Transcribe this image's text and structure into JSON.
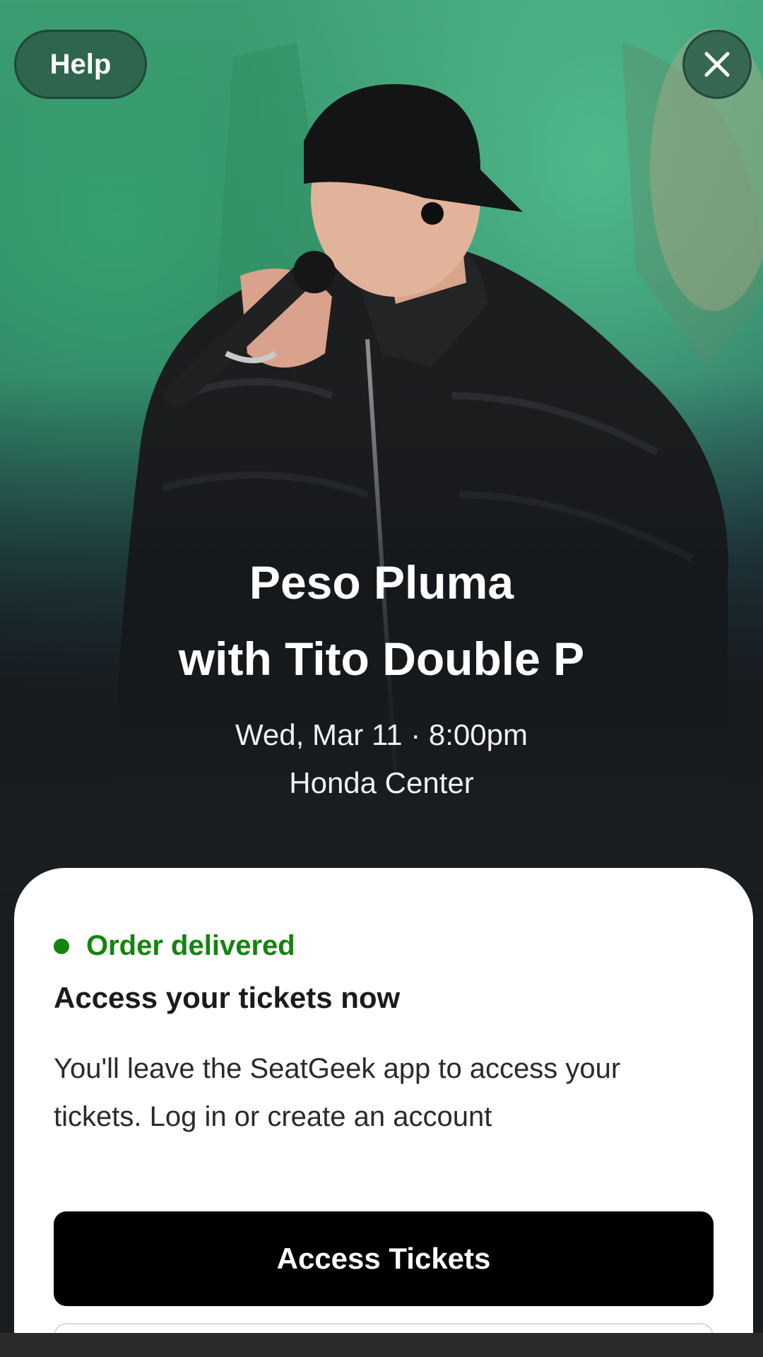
{
  "header": {
    "help_label": "Help",
    "close_icon": "close-icon"
  },
  "event": {
    "title_line1": "Peso Pluma",
    "title_line2": "with Tito Double P",
    "datetime": "Wed, Mar 11 · 8:00pm",
    "venue": "Honda Center"
  },
  "order": {
    "status": "Order delivered",
    "status_color": "#13840f",
    "heading": "Access your tickets now",
    "body": "You'll leave the SeatGeek app to access your tickets. Log in or create an account",
    "primary_button": "Access Tickets"
  },
  "colors": {
    "hero_green": "#3f9a72",
    "button_black": "#000000",
    "card_white": "#ffffff"
  }
}
